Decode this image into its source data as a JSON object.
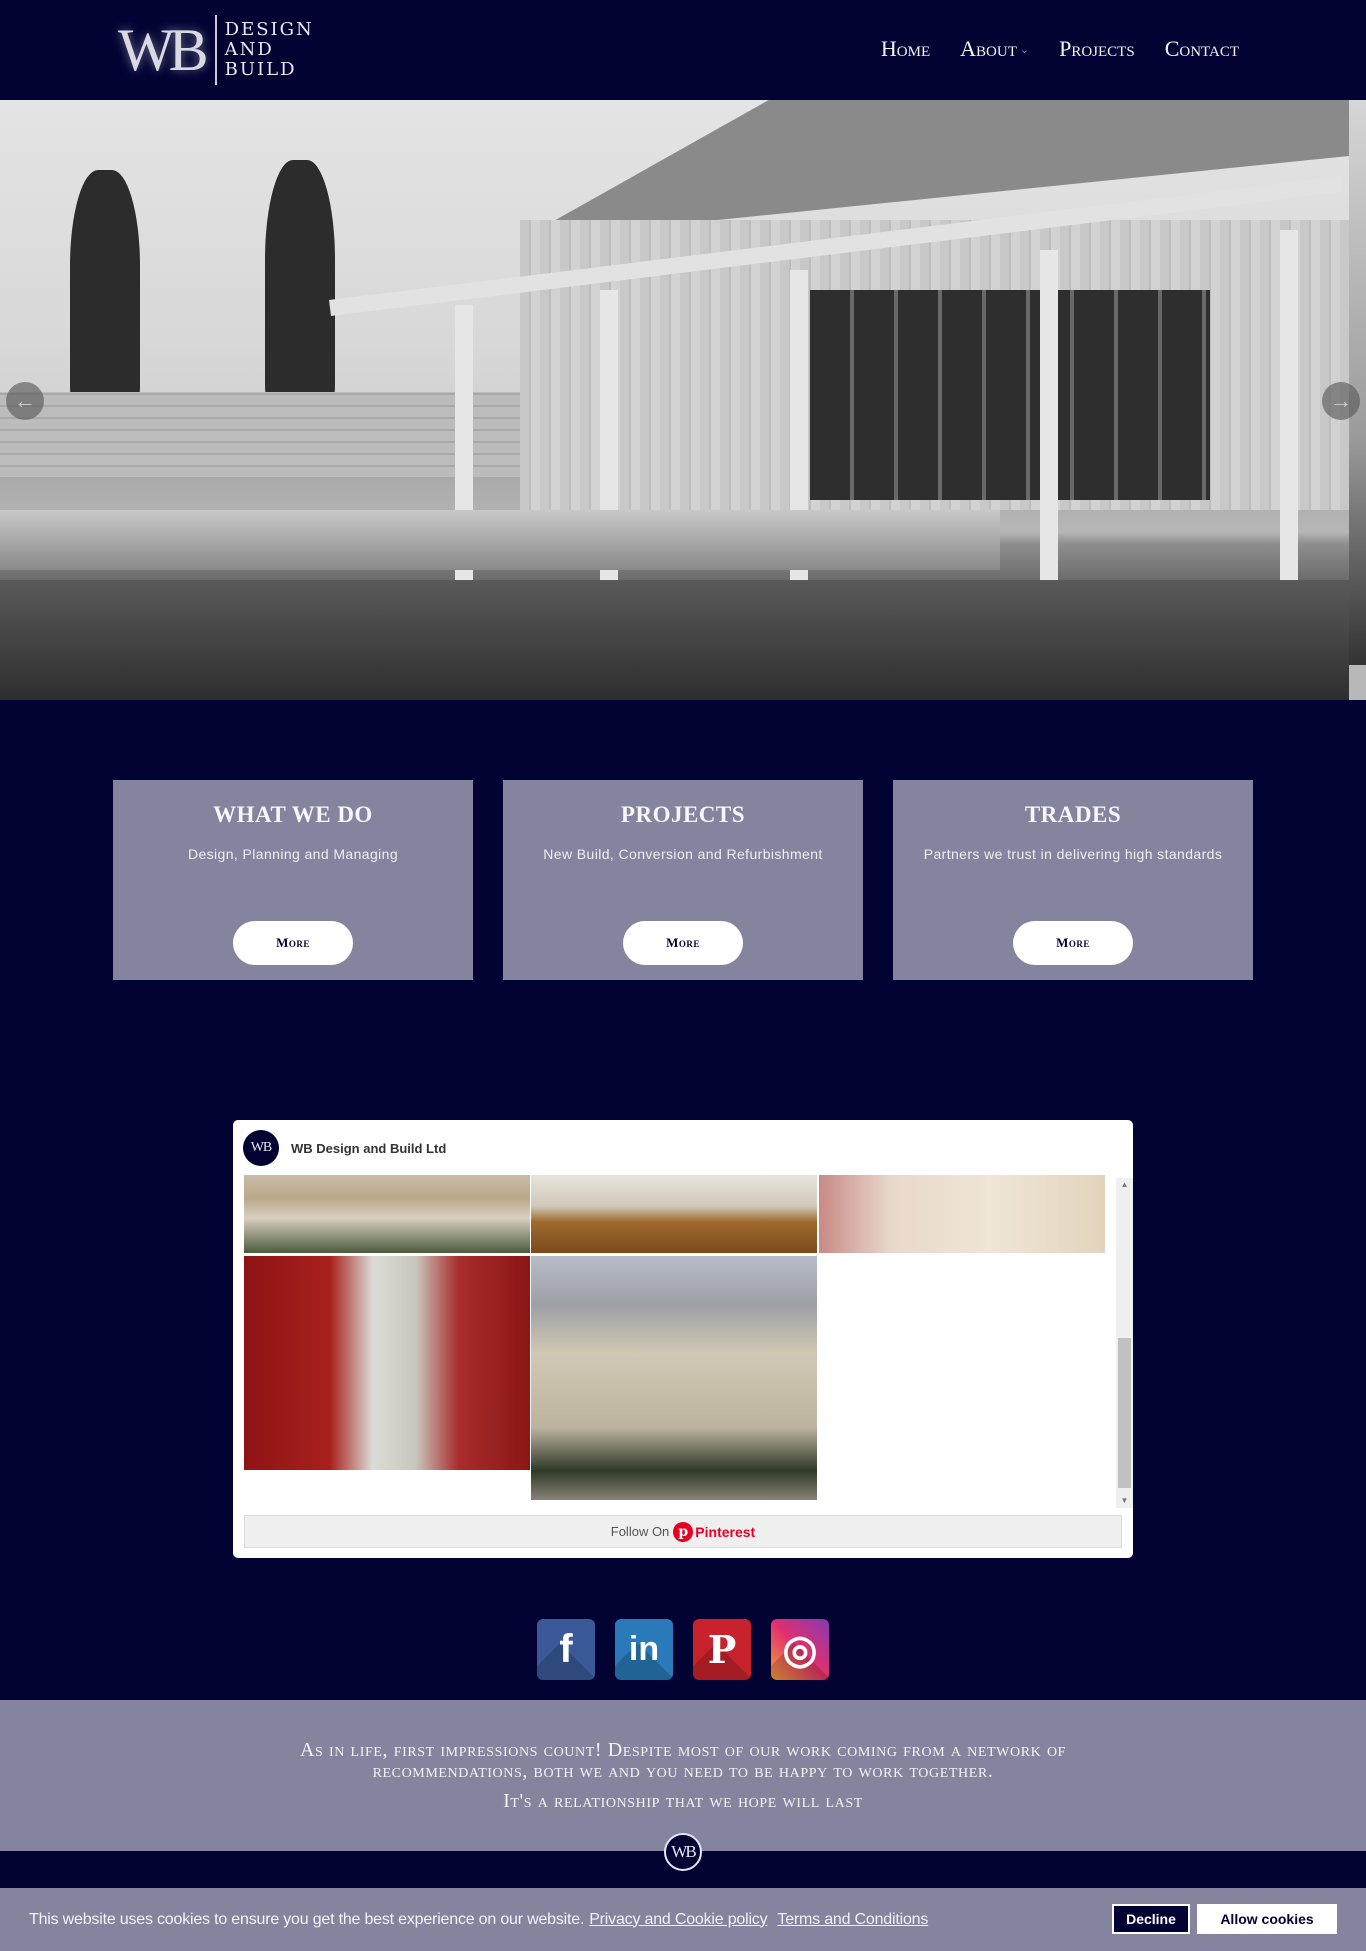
{
  "header": {
    "logo": {
      "mark": "WB",
      "lines": [
        "DESIGN",
        "AND",
        "BUILD"
      ]
    },
    "nav": [
      {
        "label": "Home"
      },
      {
        "label": "About",
        "has_dropdown": true
      },
      {
        "label": "Projects"
      },
      {
        "label": "Contact"
      }
    ]
  },
  "hero": {
    "prev_icon": "arrow-left-icon",
    "next_icon": "arrow-right-icon",
    "prev_glyph": "←",
    "next_glyph": "→"
  },
  "cards": [
    {
      "title": "WHAT WE DO",
      "description": "Design, Planning and Managing",
      "button": "More"
    },
    {
      "title": "PROJECTS",
      "description": "New Build, Conversion and Refurbishment",
      "button": "More"
    },
    {
      "title": "TRADES",
      "description": "Partners we trust in delivering high standards",
      "button": "More"
    }
  ],
  "pinterest": {
    "avatar": "WB",
    "account_name": "WB Design and Build Ltd",
    "follow_prefix": "Follow On",
    "follow_logo": "p",
    "follow_brand": "Pinterest",
    "images": [
      "garages-courtyard",
      "table-tennis-room",
      "hallway-sofa",
      "bay-window-red-curtains",
      "stone-manor-house"
    ]
  },
  "social": [
    {
      "name": "facebook",
      "glyph": "f",
      "color": "#3b5998"
    },
    {
      "name": "linkedin",
      "glyph": "in",
      "color": "#2a79b8"
    },
    {
      "name": "pinterest",
      "glyph": "P",
      "color": "#c8232c"
    },
    {
      "name": "instagram",
      "glyph": "◎",
      "color": "#c13584"
    }
  ],
  "quote": {
    "line1": "As in life, first impressions count! Despite most of our work coming from a network of",
    "line2": "recommendations, both we and you need to be happy to work together.",
    "line3": "It's a relationship that we hope will last",
    "badge": "WB"
  },
  "cookie": {
    "message": "This website uses cookies to ensure you get the best experience on our website.",
    "privacy_link": "Privacy and Cookie policy",
    "terms_link": "Terms and Conditions",
    "decline": "Decline",
    "allow": "Allow cookies"
  },
  "colors": {
    "navy": "#020233",
    "slate": "#84849e",
    "pinterest_red": "#e60023"
  }
}
